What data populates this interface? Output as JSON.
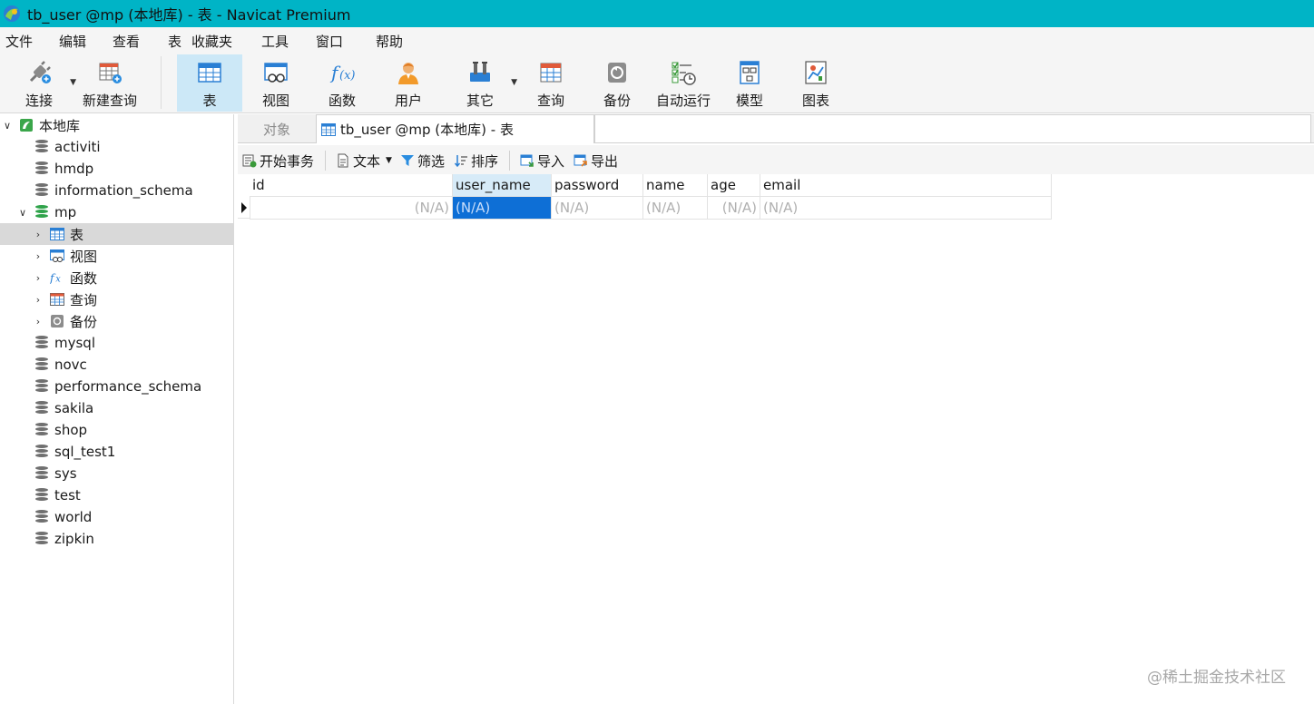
{
  "window": {
    "title": "tb_user @mp (本地库) - 表 - Navicat Premium"
  },
  "menu": [
    "文件",
    "编辑",
    "查看",
    "表",
    "收藏夹",
    "工具",
    "窗口",
    "帮助"
  ],
  "toolbar": {
    "connect": "连接",
    "new_query": "新建查询",
    "table": "表",
    "view": "视图",
    "function": "函数",
    "user": "用户",
    "other": "其它",
    "query": "查询",
    "backup": "备份",
    "auto_run": "自动运行",
    "model": "模型",
    "chart": "图表"
  },
  "sidebar": {
    "root": "本地库",
    "databases": [
      "activiti",
      "hmdp",
      "information_schema",
      "mp",
      "mysql",
      "novc",
      "performance_schema",
      "sakila",
      "shop",
      "sql_test1",
      "sys",
      "test",
      "world",
      "zipkin"
    ],
    "mp_children": [
      "表",
      "视图",
      "函数",
      "查询",
      "备份"
    ]
  },
  "tabs": {
    "objects": "对象",
    "current": "tb_user @mp (本地库) - 表"
  },
  "subtoolbar": {
    "begin_transaction": "开始事务",
    "text": "文本",
    "filter": "筛选",
    "sort": "排序",
    "import": "导入",
    "export": "导出"
  },
  "grid": {
    "columns": [
      "id",
      "user_name",
      "password",
      "name",
      "age",
      "email"
    ],
    "rows": [
      [
        "(N/A)",
        "(N/A)",
        "(N/A)",
        "(N/A)",
        "(N/A)",
        "(N/A)"
      ]
    ],
    "selected_column": "user_name"
  },
  "watermark": "@稀土掘金技术社区",
  "colors": {
    "titlebar": "#00b4c6",
    "selection": "#0e6fd6",
    "active_tool": "#cce8f7"
  }
}
